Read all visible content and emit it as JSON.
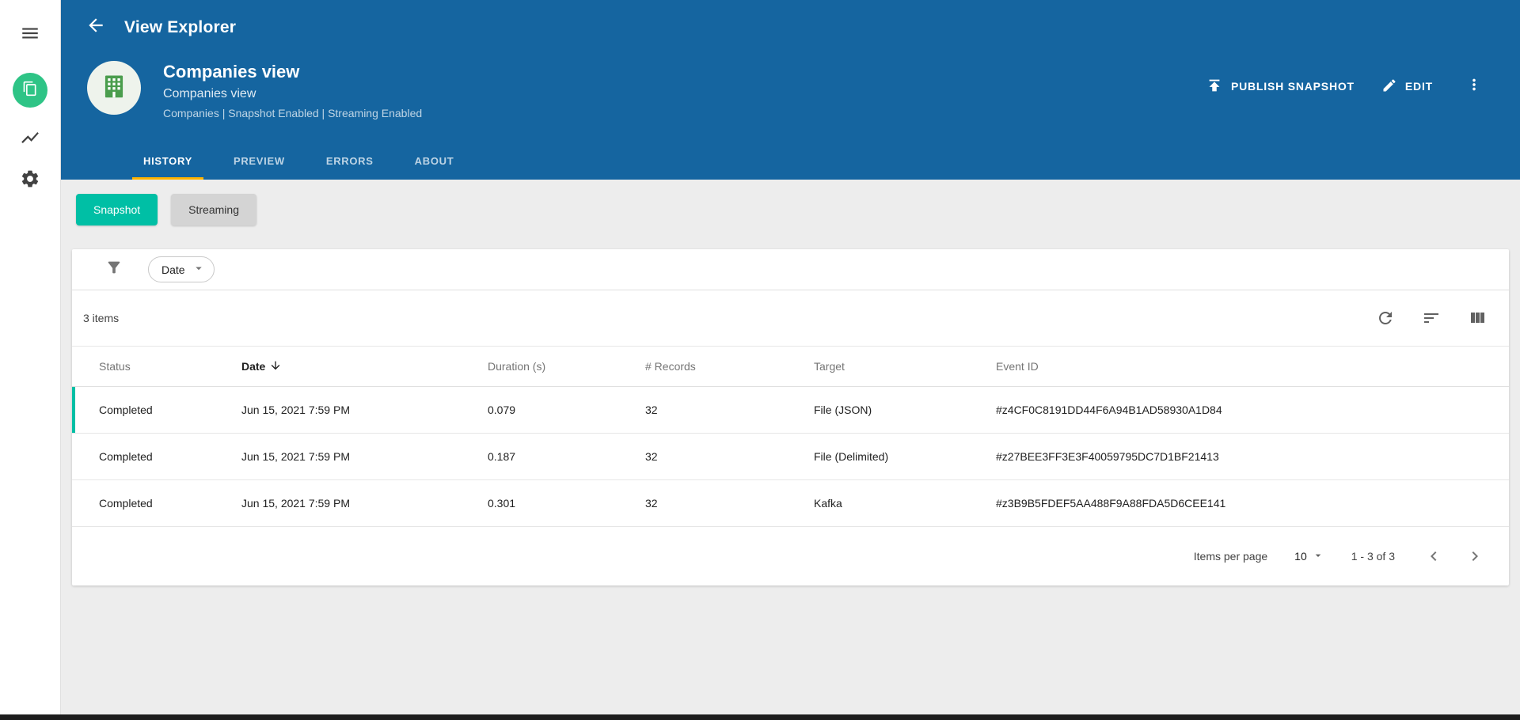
{
  "colors": {
    "header_blue": "#1565a0",
    "accent_teal": "#00bfa5",
    "tab_underline": "#ffb300",
    "sidebar_icon_green": "#2ec486",
    "avatar_green": "#4a9d4d"
  },
  "topbar": {
    "title": "View Explorer"
  },
  "entity": {
    "title": "Companies view",
    "subtitle": "Companies view",
    "meta": "Companies | Snapshot Enabled | Streaming Enabled"
  },
  "actions": {
    "publish": "PUBLISH SNAPSHOT",
    "edit": "EDIT"
  },
  "tabs": [
    {
      "label": "HISTORY"
    },
    {
      "label": "PREVIEW"
    },
    {
      "label": "ERRORS"
    },
    {
      "label": "ABOUT"
    }
  ],
  "toggles": {
    "snapshot": "Snapshot",
    "streaming": "Streaming"
  },
  "filter": {
    "date": "Date"
  },
  "table": {
    "count": "3 items",
    "headers": {
      "status": "Status",
      "date": "Date",
      "duration": "Duration (s)",
      "records": "# Records",
      "target": "Target",
      "event_id": "Event ID"
    },
    "rows": [
      {
        "status": "Completed",
        "date": "Jun 15, 2021 7:59 PM",
        "duration": "0.079",
        "records": "32",
        "target": "File (JSON)",
        "event_id": "#z4CF0C8191DD44F6A94B1AD58930A1D84"
      },
      {
        "status": "Completed",
        "date": "Jun 15, 2021 7:59 PM",
        "duration": "0.187",
        "records": "32",
        "target": "File (Delimited)",
        "event_id": "#z27BEE3FF3E3F40059795DC7D1BF21413"
      },
      {
        "status": "Completed",
        "date": "Jun 15, 2021 7:59 PM",
        "duration": "0.301",
        "records": "32",
        "target": "Kafka",
        "event_id": "#z3B9B5FDEF5AA488F9A88FDA5D6CEE141"
      }
    ]
  },
  "pagination": {
    "label": "Items per page",
    "size": "10",
    "range": "1 - 3 of 3"
  }
}
